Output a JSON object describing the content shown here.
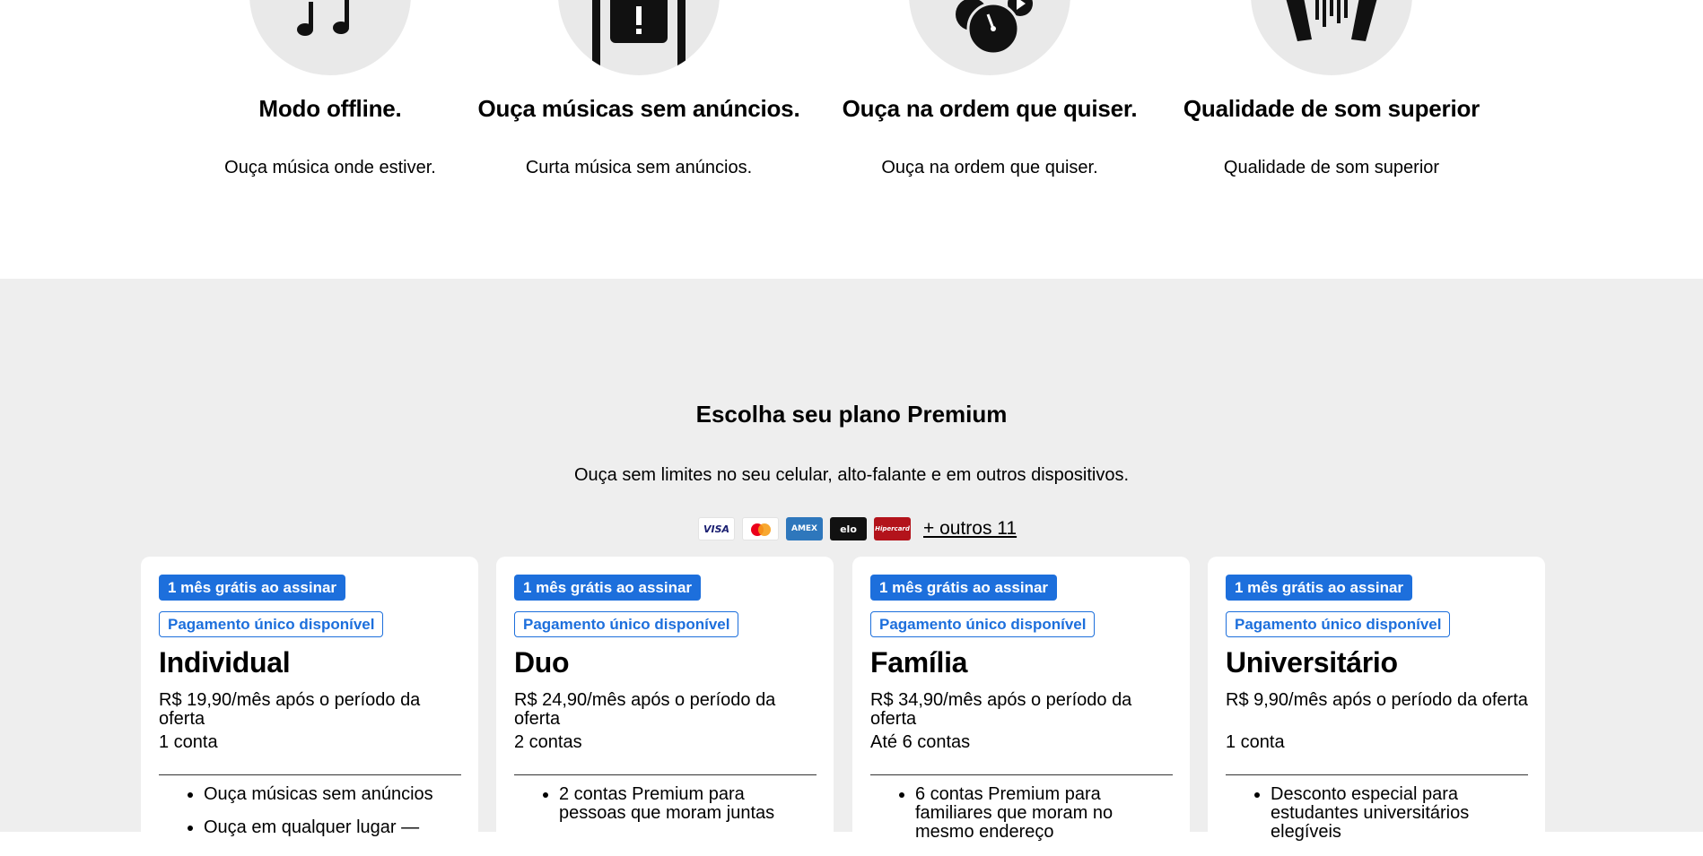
{
  "features": [
    {
      "icon": "music-notes-icon",
      "title": "Modo offline.",
      "text": "Ouça música onde estiver."
    },
    {
      "icon": "no-ads-icon",
      "title": "Ouça músicas sem anúncios.",
      "text": "Curta música sem anúncios."
    },
    {
      "icon": "shuffle-order-icon",
      "title": "Ouça na ordem que quiser.",
      "text": "Ouça na ordem que quiser."
    },
    {
      "icon": "sound-quality-icon",
      "title": "Qualidade de som superior",
      "text": "Qualidade de som superior"
    }
  ],
  "plans_section": {
    "title": "Escolha seu plano Premium",
    "subtitle": "Ouça sem limites no seu celular, alto-falante e em outros dispositivos.",
    "payment_methods": [
      {
        "name": "visa-icon",
        "label": "VISA"
      },
      {
        "name": "mastercard-icon",
        "label": ""
      },
      {
        "name": "amex-icon",
        "label": "AMEX"
      },
      {
        "name": "elo-icon",
        "label": "elo"
      },
      {
        "name": "hipercard-icon",
        "label": "Hipercard"
      }
    ],
    "more_payments_label": "+ outros 11"
  },
  "plans": [
    {
      "badge_trial": "1 mês grátis ao assinar",
      "badge_payment": "Pagamento único disponível",
      "name": "Individual",
      "price": "R$ 19,90/mês após o período da oferta",
      "accounts": "1 conta",
      "features": [
        "Ouça músicas sem anúncios",
        "Ouça em qualquer lugar —"
      ]
    },
    {
      "badge_trial": "1 mês grátis ao assinar",
      "badge_payment": "Pagamento único disponível",
      "name": "Duo",
      "price": "R$ 24,90/mês após o período da oferta",
      "accounts": "2 contas",
      "features": [
        "2 contas Premium para pessoas que moram juntas"
      ]
    },
    {
      "badge_trial": "1 mês grátis ao assinar",
      "badge_payment": "Pagamento único disponível",
      "name": "Família",
      "price": "R$ 34,90/mês após o período da oferta",
      "accounts": "Até 6 contas",
      "features": [
        "6 contas Premium para familiares que moram no mesmo endereço"
      ]
    },
    {
      "badge_trial": "1 mês grátis ao assinar",
      "badge_payment": "Pagamento único disponível",
      "name": "Universitário",
      "price": "R$ 9,90/mês após o período da oferta",
      "accounts": "1 conta",
      "features": [
        "Desconto especial para estudantes universitários elegíveis"
      ]
    }
  ],
  "colors": {
    "accent_blue": "#1d6fdc",
    "section_bg": "#eeeeee",
    "icon_circle": "#e9e9e9"
  }
}
